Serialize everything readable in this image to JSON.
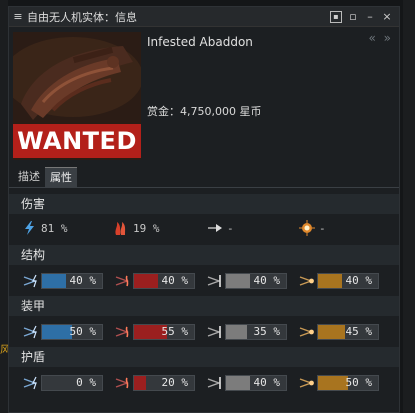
{
  "background": {
    "edge_char": "风"
  },
  "window": {
    "title": "自由无人机实体：信息",
    "controls": [
      "menu",
      "lock",
      "pin",
      "minimize",
      "close"
    ]
  },
  "header": {
    "ship_name": "Infested Abaddon",
    "bounty": "赏金：4,750,000 星币",
    "wanted_label": "WANTED",
    "collapse_glyph": "« »"
  },
  "tabs": [
    {
      "label": "描述",
      "active": false
    },
    {
      "label": "属性",
      "active": true
    }
  ],
  "sections": {
    "damage": {
      "title": "伤害",
      "items": [
        {
          "icon": "em-damage-icon",
          "value": "81 %"
        },
        {
          "icon": "thermal-damage-icon",
          "value": "19 %"
        },
        {
          "icon": "kinetic-damage-icon",
          "value": "-"
        },
        {
          "icon": "explosive-damage-icon",
          "value": "-"
        }
      ]
    },
    "structure": {
      "title": "结构",
      "resists": [
        {
          "type": "em",
          "value": "40 %",
          "fraction": 0.4
        },
        {
          "type": "thermal",
          "value": "40 %",
          "fraction": 0.4
        },
        {
          "type": "kinetic",
          "value": "40 %",
          "fraction": 0.4
        },
        {
          "type": "explosive",
          "value": "40 %",
          "fraction": 0.4
        }
      ]
    },
    "armor": {
      "title": "装甲",
      "resists": [
        {
          "type": "em",
          "value": "50 %",
          "fraction": 0.5
        },
        {
          "type": "thermal",
          "value": "55 %",
          "fraction": 0.55
        },
        {
          "type": "kinetic",
          "value": "35 %",
          "fraction": 0.35
        },
        {
          "type": "explosive",
          "value": "45 %",
          "fraction": 0.45
        }
      ]
    },
    "shield": {
      "title": "护盾",
      "resists": [
        {
          "type": "em",
          "value": "0 %",
          "fraction": 0.0
        },
        {
          "type": "thermal",
          "value": "20 %",
          "fraction": 0.2
        },
        {
          "type": "kinetic",
          "value": "40 %",
          "fraction": 0.4
        },
        {
          "type": "explosive",
          "value": "50 %",
          "fraction": 0.5
        }
      ]
    }
  },
  "colors": {
    "em": "#2e6fa6",
    "thermal": "#9b1f1f",
    "kinetic": "#7c7c7c",
    "explosive": "#a8741f",
    "wanted_bg": "#b3201a"
  }
}
